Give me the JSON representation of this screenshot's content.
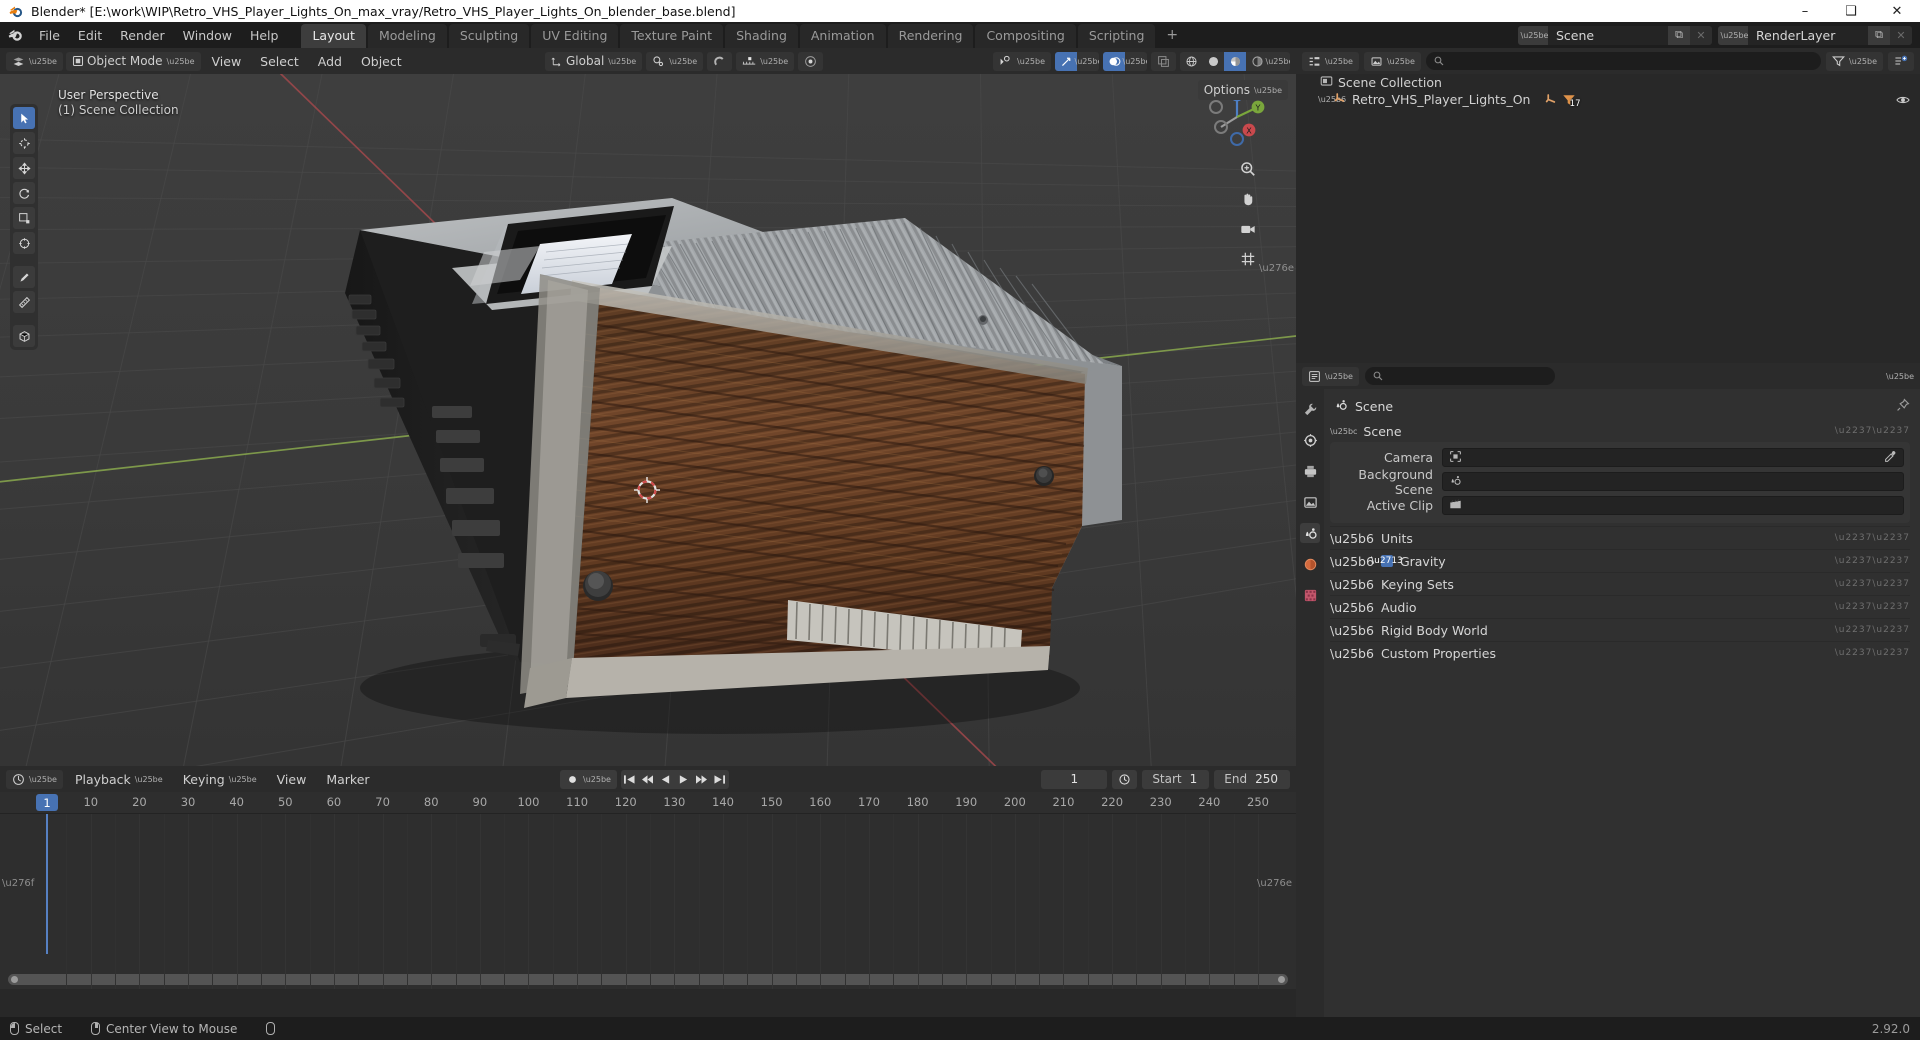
{
  "window": {
    "title": "Blender* [E:\\work\\WIP\\Retro_VHS_Player_Lights_On_max_vray/Retro_VHS_Player_Lights_On_blender_base.blend]",
    "minimize": "–",
    "maximize": "❑",
    "close": "✕"
  },
  "topbar": {
    "menus": [
      "File",
      "Edit",
      "Render",
      "Window",
      "Help"
    ],
    "workspaces": [
      {
        "label": "Layout",
        "active": true
      },
      {
        "label": "Modeling",
        "active": false
      },
      {
        "label": "Sculpting",
        "active": false
      },
      {
        "label": "UV Editing",
        "active": false
      },
      {
        "label": "Texture Paint",
        "active": false
      },
      {
        "label": "Shading",
        "active": false
      },
      {
        "label": "Animation",
        "active": false
      },
      {
        "label": "Rendering",
        "active": false
      },
      {
        "label": "Compositing",
        "active": false
      },
      {
        "label": "Scripting",
        "active": false
      }
    ],
    "add_workspace": "+",
    "scene": {
      "name": "Scene",
      "new_label": "⧉",
      "remove_label": "✕"
    },
    "viewlayer": {
      "name": "RenderLayer",
      "new_label": "⧉",
      "remove_label": "✕"
    }
  },
  "viewport": {
    "mode": "Object Mode",
    "menus": [
      "View",
      "Select",
      "Add",
      "Object"
    ],
    "transform_orientation": "Global",
    "options_label": "Options",
    "info_line1": "User Perspective",
    "info_line2": "(1) Scene Collection",
    "gizmo_axes": {
      "x": "X",
      "y": "Y",
      "z": "Z"
    },
    "tools": [
      "tweak-select-tool",
      "cursor-tool",
      "move-tool",
      "rotate-tool",
      "scale-tool",
      "transform-tool",
      "annotate-tool",
      "measure-tool",
      "add-cube-tool"
    ]
  },
  "outliner": {
    "display_mode": "view-layer",
    "search_placeholder": "",
    "rows": [
      {
        "label": "Scene Collection",
        "icon": "collection-icon",
        "depth": 0,
        "expandable": false
      },
      {
        "label": "Retro_VHS_Player_Lights_On",
        "icon": "mesh-data-icon",
        "depth": 1,
        "expandable": true,
        "modifier_count": "17"
      }
    ]
  },
  "properties": {
    "search_placeholder": "",
    "breadcrumb": "Scene",
    "tabs": [
      "tool-icon",
      "render-icon",
      "output-icon",
      "view-layer-icon",
      "scene-icon",
      "world-icon",
      "texture-icon"
    ],
    "active_tab_index": 4,
    "panels": [
      {
        "label": "Scene",
        "open": true
      },
      {
        "label": "Units",
        "open": false
      },
      {
        "label": "Gravity",
        "open": false,
        "checkbox": true
      },
      {
        "label": "Keying Sets",
        "open": false
      },
      {
        "label": "Audio",
        "open": false
      },
      {
        "label": "Rigid Body World",
        "open": false
      },
      {
        "label": "Custom Properties",
        "open": false
      }
    ],
    "scene_fields": [
      {
        "label": "Camera",
        "value": "",
        "icon": "camera-icon",
        "eyedropper": true
      },
      {
        "label": "Background Scene",
        "value": "",
        "icon": "scene-icon",
        "eyedropper": false
      },
      {
        "label": "Active Clip",
        "value": "",
        "icon": "clip-icon",
        "eyedropper": false
      }
    ]
  },
  "timeline": {
    "menus": [
      "Playback",
      "Keying",
      "View",
      "Marker"
    ],
    "current_frame": "1",
    "start_label": "Start",
    "start_value": "1",
    "end_label": "End",
    "end_value": "250",
    "ruler_ticks": [
      "1",
      "10",
      "20",
      "30",
      "40",
      "50",
      "60",
      "70",
      "80",
      "90",
      "100",
      "110",
      "120",
      "130",
      "140",
      "150",
      "160",
      "170",
      "180",
      "190",
      "200",
      "210",
      "220",
      "230",
      "240",
      "250"
    ],
    "playhead_frame": "1"
  },
  "statusbar": {
    "items": [
      {
        "label": "Select",
        "mouse": "left"
      },
      {
        "label": "Center View to Mouse",
        "mouse": "middle"
      },
      {
        "label": "",
        "mouse": "right"
      }
    ],
    "version": "2.92.0"
  },
  "colors": {
    "accent_blue": "#4772b3",
    "panel_bg": "#303030",
    "header_bg": "#2b2b2b",
    "viewport_bg": "#3b3b3b",
    "outliner_bg": "#282828",
    "mesh_orange": "#e5a05a",
    "axis_x": "#c04a4a",
    "axis_y": "#7aa63c"
  }
}
